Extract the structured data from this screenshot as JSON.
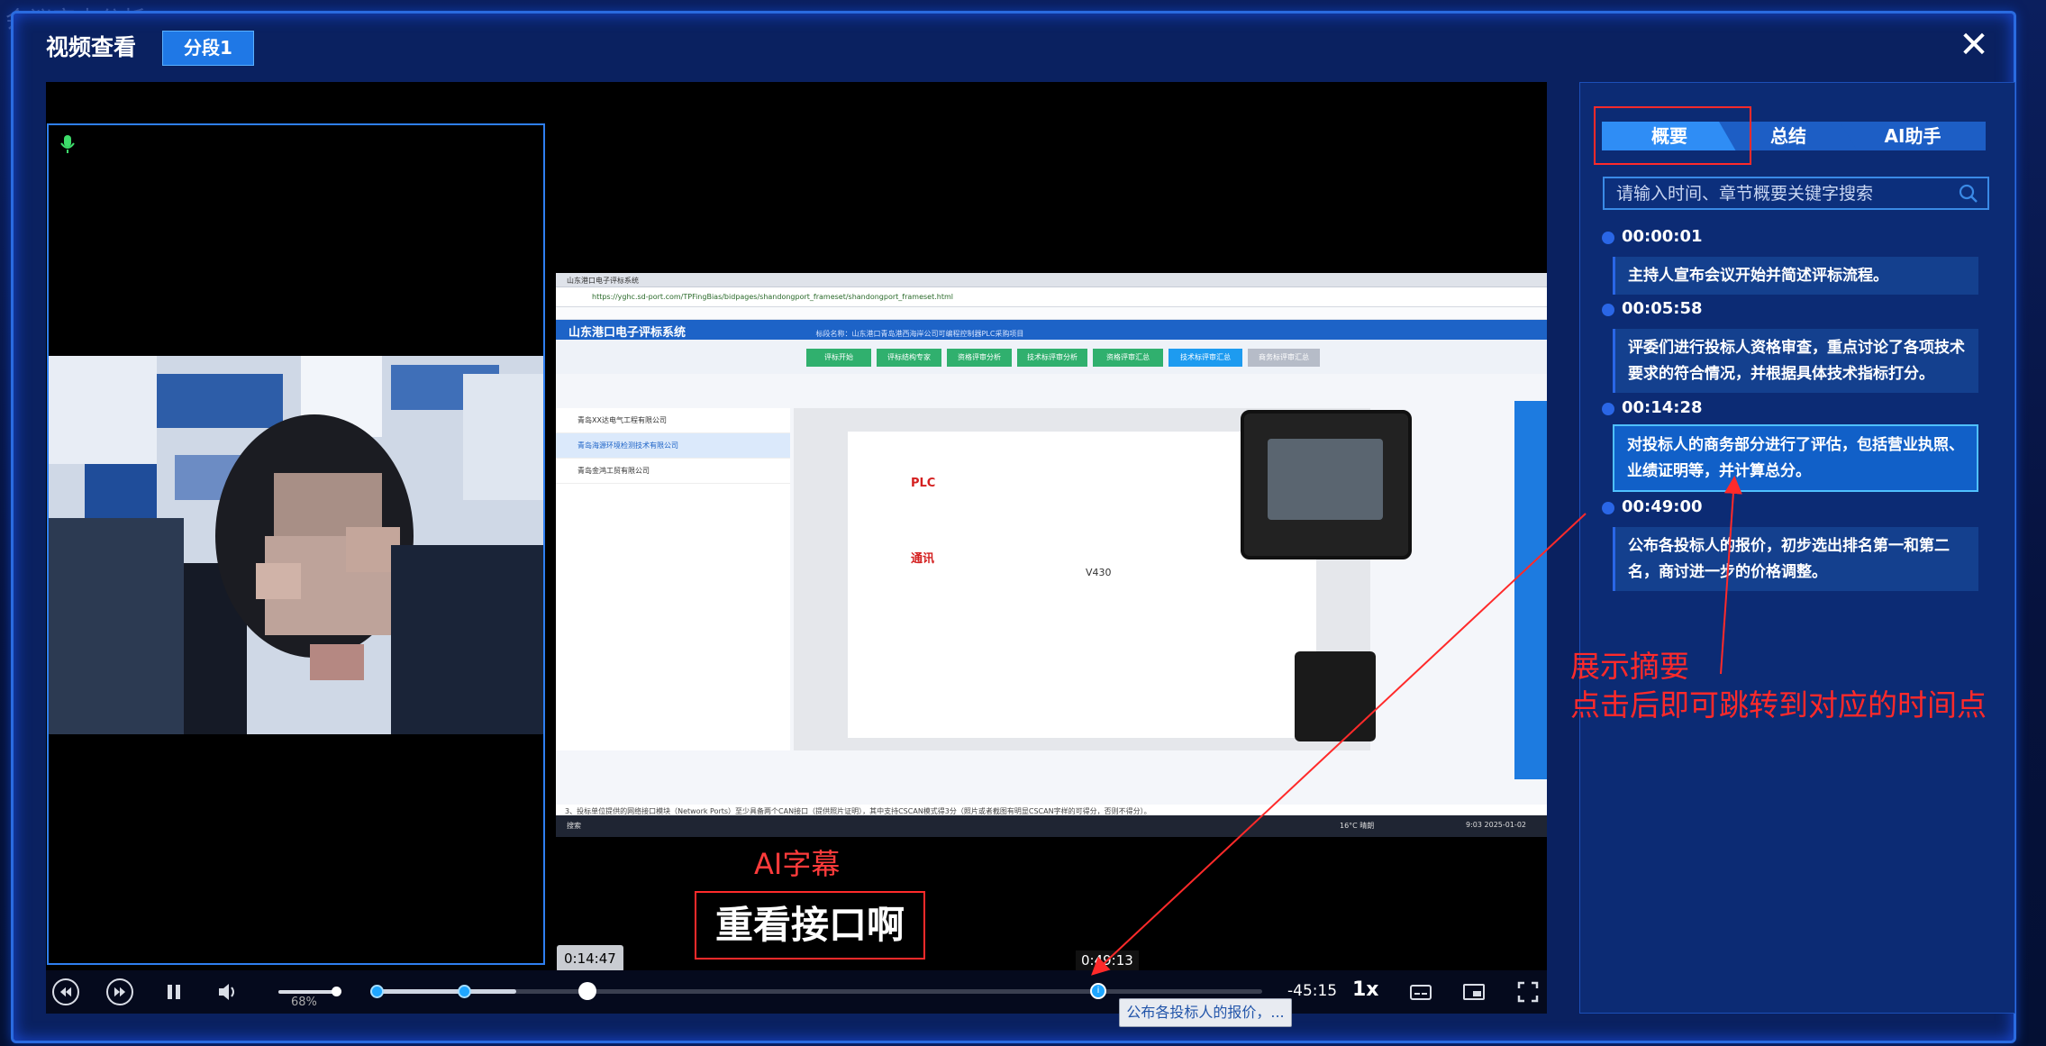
{
  "background": {
    "title": "会议审查分析"
  },
  "modal": {
    "title": "视频查看",
    "segment_tab": "分段1",
    "close_symbol": "✕"
  },
  "screen_share": {
    "browser_tab": "山东港口电子评标系统",
    "url": "https://yghc.sd-port.com/TPFingBias/bidpages/shandongport_frameset/shandongport_frameset.html",
    "app_title": "山东港口电子评标系统",
    "project_name": "标段名称：山东港口青岛港西海岸公司可编程控制器PLC采购项目",
    "steps": [
      "评标开始",
      "评标结构专家",
      "资格评审分析",
      "技术标评审分析",
      "资格评审汇总",
      "技术标评审汇总",
      "商务标评审汇总"
    ],
    "table_rows": [
      "青岛XX达电气工程有限公司",
      "青岛海源环境检测技术有限公司",
      "青岛金鸿工贸有限公司"
    ],
    "doc_plc_heading": "PLC",
    "doc_comm_heading": "通讯",
    "device_label": "V430",
    "notice": "3、投标单位提供的网络接口模块（Network Ports）至少具备两个CAN接口（提供照片证明），其中支持CSCAN模式得3分（照片或者截图有明显CSCAN字样的可得分，否则不得分）。",
    "taskbar_weather": "16°C 晴朗",
    "taskbar_time": "9:03 2025-01-02",
    "taskbar_search": "搜索"
  },
  "overlay": {
    "ai_label": "AI字幕",
    "subtitle": "重看接口啊"
  },
  "player": {
    "current_time_bubble": "0:14:47",
    "hover_time_bubble": "0:49:13",
    "volume": "68%",
    "remaining": "-45:15",
    "speed": "1x",
    "played_fraction": 0.164,
    "marker_tooltip": "公布各投标人的报价，..."
  },
  "side_panel": {
    "tabs": [
      "概要",
      "总结",
      "AI助手"
    ],
    "search_placeholder": "请输入时间、章节概要关键字搜索",
    "items": [
      {
        "time": "00:00:01",
        "text": "主持人宣布会议开始并简述评标流程。"
      },
      {
        "time": "00:05:58",
        "text": "评委们进行投标人资格审查，重点讨论了各项技术要求的符合情况，并根据具体技术指标打分。"
      },
      {
        "time": "00:14:28",
        "text": "对投标人的商务部分进行了评估，包括营业执照、业绩证明等，并计算总分。"
      },
      {
        "time": "00:49:00",
        "text": "公布各投标人的报价，初步选出排名第一和第二名，商讨进一步的价格调整。"
      }
    ]
  },
  "callout": {
    "line1": "展示摘要",
    "line2": "点击后即可跳转到对应的时间点"
  },
  "colors": {
    "accent": "#2f8df5",
    "annotation": "#ff2a2a"
  }
}
